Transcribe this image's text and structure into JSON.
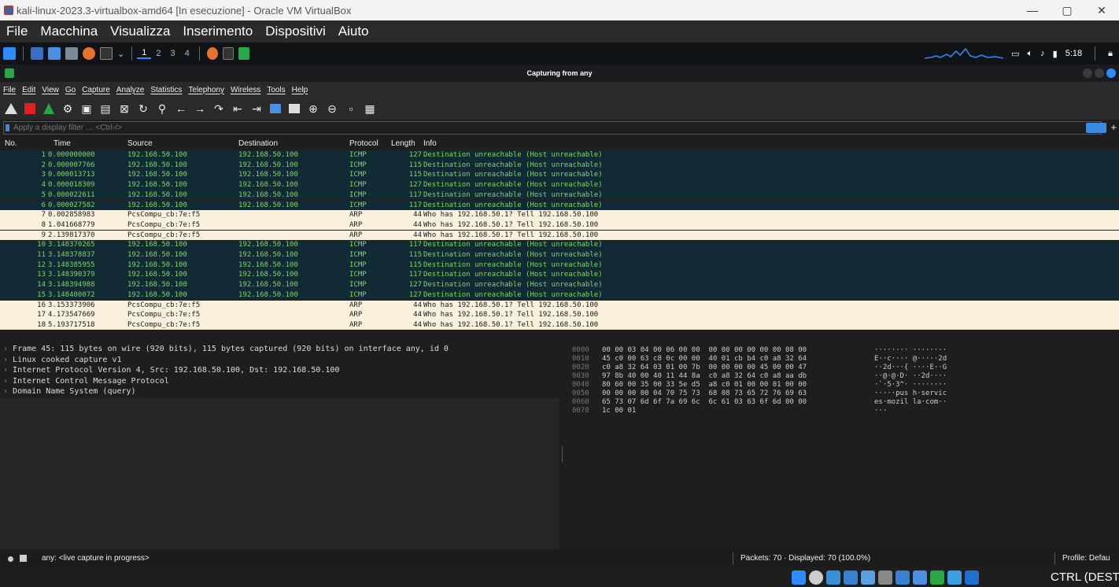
{
  "window": {
    "title": "kali-linux-2023.3-virtualbox-amd64 [In esecuzione] - Oracle VM VirtualBox",
    "minimize": "—",
    "maximize": "▢",
    "close": "✕"
  },
  "vbox_menu": [
    "File",
    "Macchina",
    "Visualizza",
    "Inserimento",
    "Dispositivi",
    "Aiuto"
  ],
  "kali_panel": {
    "workspaces": [
      "1",
      "2",
      "3",
      "4"
    ],
    "active_workspace": "1",
    "clock": "5:18"
  },
  "wireshark": {
    "title": "Capturing from any",
    "menu": [
      "File",
      "Edit",
      "View",
      "Go",
      "Capture",
      "Analyze",
      "Statistics",
      "Telephony",
      "Wireless",
      "Tools",
      "Help"
    ],
    "filter_placeholder": "Apply a display filter … <Ctrl-/>",
    "filter_plus": "+",
    "columns": [
      "No.",
      "Time",
      "Source",
      "Destination",
      "Protocol",
      "Length",
      "Info"
    ],
    "packets": [
      {
        "no": "1",
        "time": "0.000000000",
        "src": "192.168.50.100",
        "dst": "192.168.50.100",
        "proto": "ICMP",
        "len": "127",
        "info": "Destination unreachable (Host unreachable)"
      },
      {
        "no": "2",
        "time": "0.000007766",
        "src": "192.168.50.100",
        "dst": "192.168.50.100",
        "proto": "ICMP",
        "len": "115",
        "info": "Destination unreachable (Host unreachable)"
      },
      {
        "no": "3",
        "time": "0.000013713",
        "src": "192.168.50.100",
        "dst": "192.168.50.100",
        "proto": "ICMP",
        "len": "115",
        "info": "Destination unreachable (Host unreachable)"
      },
      {
        "no": "4",
        "time": "0.000018309",
        "src": "192.168.50.100",
        "dst": "192.168.50.100",
        "proto": "ICMP",
        "len": "127",
        "info": "Destination unreachable (Host unreachable)"
      },
      {
        "no": "5",
        "time": "0.000022611",
        "src": "192.168.50.100",
        "dst": "192.168.50.100",
        "proto": "ICMP",
        "len": "117",
        "info": "Destination unreachable (Host unreachable)"
      },
      {
        "no": "6",
        "time": "0.000027582",
        "src": "192.168.50.100",
        "dst": "192.168.50.100",
        "proto": "ICMP",
        "len": "117",
        "info": "Destination unreachable (Host unreachable)"
      },
      {
        "no": "7",
        "time": "0.002858983",
        "src": "PcsCompu_cb:7e:f5",
        "dst": "",
        "proto": "ARP",
        "len": "44",
        "info": "Who has 192.168.50.1? Tell 192.168.50.100"
      },
      {
        "no": "8",
        "time": "1.041668779",
        "src": "PcsCompu_cb:7e:f5",
        "dst": "",
        "proto": "ARP",
        "len": "44",
        "info": "Who has 192.168.50.1? Tell 192.168.50.100"
      },
      {
        "no": "9",
        "time": "2.139817370",
        "src": "PcsCompu_cb:7e:f5",
        "dst": "",
        "proto": "ARP",
        "len": "44",
        "info": "Who has 192.168.50.1? Tell 192.168.50.100"
      },
      {
        "no": "10",
        "time": "3.148370265",
        "src": "192.168.50.100",
        "dst": "192.168.50.100",
        "proto": "ICMP",
        "len": "117",
        "info": "Destination unreachable (Host unreachable)"
      },
      {
        "no": "11",
        "time": "3.148378837",
        "src": "192.168.50.100",
        "dst": "192.168.50.100",
        "proto": "ICMP",
        "len": "115",
        "info": "Destination unreachable (Host unreachable)"
      },
      {
        "no": "12",
        "time": "3.148385955",
        "src": "192.168.50.100",
        "dst": "192.168.50.100",
        "proto": "ICMP",
        "len": "115",
        "info": "Destination unreachable (Host unreachable)"
      },
      {
        "no": "13",
        "time": "3.148390379",
        "src": "192.168.50.100",
        "dst": "192.168.50.100",
        "proto": "ICMP",
        "len": "117",
        "info": "Destination unreachable (Host unreachable)"
      },
      {
        "no": "14",
        "time": "3.148394988",
        "src": "192.168.50.100",
        "dst": "192.168.50.100",
        "proto": "ICMP",
        "len": "127",
        "info": "Destination unreachable (Host unreachable)"
      },
      {
        "no": "15",
        "time": "3.148400072",
        "src": "192.168.50.100",
        "dst": "192.168.50.100",
        "proto": "ICMP",
        "len": "127",
        "info": "Destination unreachable (Host unreachable)"
      },
      {
        "no": "16",
        "time": "3.153373906",
        "src": "PcsCompu_cb:7e:f5",
        "dst": "",
        "proto": "ARP",
        "len": "44",
        "info": "Who has 192.168.50.1? Tell 192.168.50.100"
      },
      {
        "no": "17",
        "time": "4.173547669",
        "src": "PcsCompu_cb:7e:f5",
        "dst": "",
        "proto": "ARP",
        "len": "44",
        "info": "Who has 192.168.50.1? Tell 192.168.50.100"
      },
      {
        "no": "18",
        "time": "5.193717518",
        "src": "PcsCompu_cb:7e:f5",
        "dst": "",
        "proto": "ARP",
        "len": "44",
        "info": "Who has 192.168.50.1? Tell 192.168.50.100"
      }
    ],
    "details": [
      "Frame 45: 115 bytes on wire (920 bits), 115 bytes captured (920 bits) on interface any, id 0",
      "Linux cooked capture v1",
      "Internet Protocol Version 4, Src: 192.168.50.100, Dst: 192.168.50.100",
      "Internet Control Message Protocol",
      "Domain Name System (query)"
    ],
    "bytes": [
      {
        "off": "0000",
        "hex": "00 00 03 04 00 06 00 00  00 00 00 00 00 00 08 00",
        "ascii": "········ ········"
      },
      {
        "off": "0010",
        "hex": "45 c0 00 63 c8 0c 00 00  40 01 cb b4 c0 a8 32 64",
        "ascii": "E··c···· @·····2d"
      },
      {
        "off": "0020",
        "hex": "c0 a8 32 64 03 01 00 7b  00 00 00 00 45 00 00 47",
        "ascii": "··2d···{ ····E··G"
      },
      {
        "off": "0030",
        "hex": "97 8b 40 00 40 11 44 8a  c0 a8 32 64 c0 a8 aa db",
        "ascii": "··@·@·D· ··2d····"
      },
      {
        "off": "0040",
        "hex": "80 60 00 35 00 33 5e d5  a8 c0 01 00 00 01 00 00",
        "ascii": "·`·5·3^· ········"
      },
      {
        "off": "0050",
        "hex": "00 00 00 00 04 70 75 73  68 08 73 65 72 76 69 63",
        "ascii": "·····pus h·servic"
      },
      {
        "off": "0060",
        "hex": "65 73 07 6d 6f 7a 69 6c  6c 61 03 63 6f 6d 00 00",
        "ascii": "es·mozil la·com··"
      },
      {
        "off": "0070",
        "hex": "1c 00 01",
        "ascii": "···"
      }
    ],
    "status": {
      "capture": "any: <live capture in progress>",
      "packets": "Packets: 70 · Displayed: 70 (100.0%)",
      "profile": "Profile: Defau"
    }
  },
  "host_bar": {
    "ctrl_label": "CTRL (DESTR"
  },
  "colors": {
    "icmp_row_bg": "#122a33",
    "icmp_row_fg": "#7fd46a",
    "arp_row_bg": "#faf0dc",
    "accent": "#3b88e0"
  }
}
